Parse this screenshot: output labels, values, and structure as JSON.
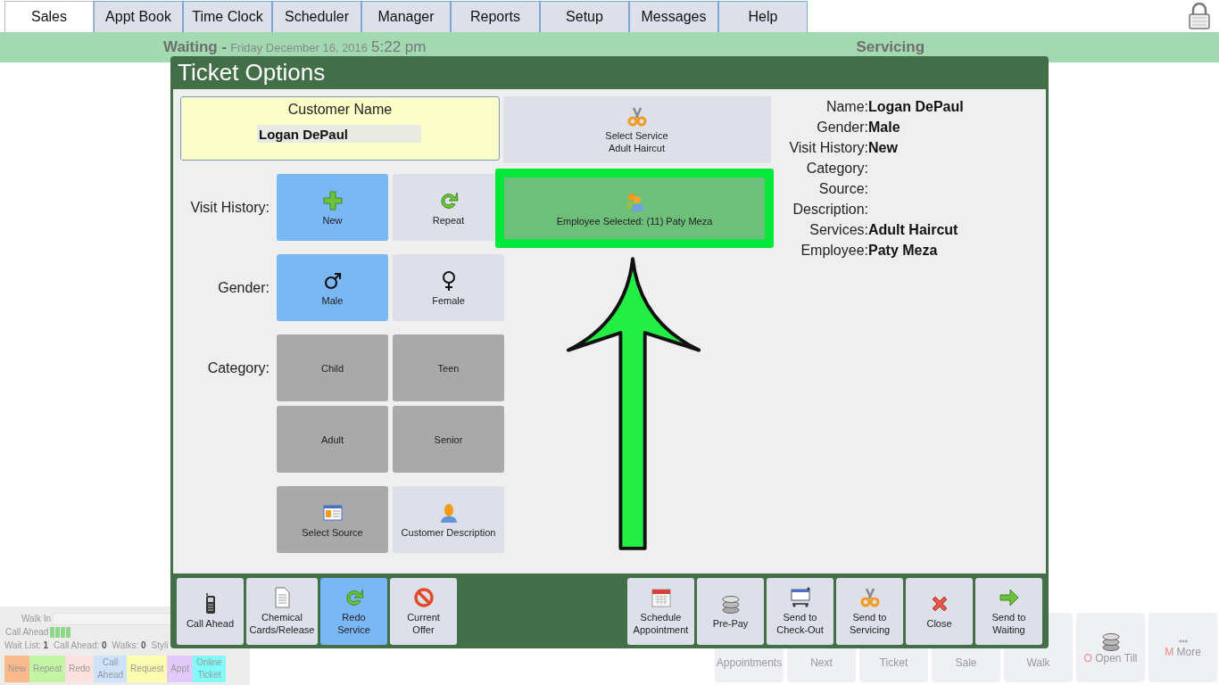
{
  "tabs": [
    {
      "label": "Sales",
      "selected": true
    },
    {
      "label": "Appt Book",
      "selected": false
    },
    {
      "label": "Time Clock",
      "selected": false
    },
    {
      "label": "Scheduler",
      "selected": false
    },
    {
      "label": "Manager",
      "selected": false
    },
    {
      "label": "Reports",
      "selected": false
    },
    {
      "label": "Setup",
      "selected": false
    },
    {
      "label": "Messages",
      "selected": false
    },
    {
      "label": "Help",
      "selected": false
    }
  ],
  "status_bar": {
    "waiting_label": "Waiting -",
    "date": "Friday December 16, 2016",
    "time": "5:22 pm",
    "servicing_label": "Servicing"
  },
  "queue_panel": {
    "walk_in_label": "Walk In",
    "call_ahead_label": "Call Ahead",
    "stats": [
      {
        "label": "Wait List:",
        "value": "1"
      },
      {
        "label": "Call Ahead:",
        "value": "0"
      },
      {
        "label": "Walks:",
        "value": "0"
      },
      {
        "label": "Styli"
      }
    ],
    "legend": [
      {
        "lines": [
          "New"
        ],
        "color": "#f9b98a"
      },
      {
        "lines": [
          "Repeat"
        ],
        "color": "#c3f5a5"
      },
      {
        "lines": [
          "Redo"
        ],
        "color": "#fde0e0"
      },
      {
        "lines": [
          "Call",
          "Ahead"
        ],
        "color": "#cce3fb"
      },
      {
        "lines": [
          "Request"
        ],
        "color": "#fdfdb0"
      },
      {
        "lines": [
          "Appt"
        ],
        "color": "#e3c9fa"
      },
      {
        "lines": [
          "Online",
          "Ticket"
        ],
        "color": "#80fbf7"
      }
    ]
  },
  "quick_actions": [
    {
      "kind": "partial",
      "lines": [
        "Appointments"
      ]
    },
    {
      "kind": "partial",
      "lines": [
        "Next"
      ]
    },
    {
      "kind": "partial",
      "lines": [
        "Ticket"
      ]
    },
    {
      "kind": "partial",
      "lines": [
        "Sale"
      ]
    },
    {
      "kind": "partial",
      "lines": [
        "Walk"
      ]
    },
    {
      "kind": "full",
      "hotkey": "O",
      "lines": [
        "Open Till"
      ]
    },
    {
      "kind": "full",
      "hotkey": "M",
      "lines": [
        "More"
      ]
    }
  ],
  "dialog": {
    "title": "Ticket Options",
    "customer_name": {
      "label": "Customer Name",
      "value": "Logan DePaul"
    },
    "visit_history": {
      "label": "Visit History:",
      "options": [
        {
          "label": "New",
          "selected": true,
          "dimmed": false
        },
        {
          "label": "Repeat",
          "selected": false,
          "dimmed": false
        }
      ]
    },
    "gender": {
      "label": "Gender:",
      "options": [
        {
          "label": "Male",
          "selected": true,
          "dimmed": false
        },
        {
          "label": "Female",
          "selected": false,
          "dimmed": false
        }
      ]
    },
    "category": {
      "label": "Category:",
      "options": [
        {
          "label": "Child",
          "selected": false,
          "dimmed": true
        },
        {
          "label": "Teen",
          "selected": false,
          "dimmed": true
        },
        {
          "label": "Adult",
          "selected": false,
          "dimmed": true
        },
        {
          "label": "Senior",
          "selected": false,
          "dimmed": true
        }
      ]
    },
    "extras": [
      {
        "label": "Select Source",
        "selected": false,
        "dimmed": true
      },
      {
        "label": "Customer Description",
        "selected": false,
        "dimmed": false
      }
    ],
    "service_button": {
      "title": "Select Service",
      "value": "Adult Haircut"
    },
    "employee_button": {
      "text": "Employee Selected: (11) Paty Meza",
      "highlighted": true
    },
    "summary": [
      {
        "label": "Name:",
        "value": "Logan DePaul"
      },
      {
        "label": "Gender:",
        "value": "Male"
      },
      {
        "label": "Visit History:",
        "value": "New"
      },
      {
        "label": "Category:"
      },
      {
        "label": "Source:"
      },
      {
        "label": "Description:"
      },
      {
        "label": "Services:",
        "value": "Adult Haircut"
      },
      {
        "label": "Employee:",
        "value": "Paty Meza"
      }
    ],
    "footer_left": [
      {
        "lines": [
          "Call Ahead"
        ],
        "selected": false
      },
      {
        "lines": [
          "Chemical",
          "Cards/Release"
        ],
        "selected": false
      },
      {
        "lines": [
          "Redo",
          "Service"
        ],
        "selected": true
      },
      {
        "lines": [
          "Current",
          "Offer"
        ],
        "selected": false
      }
    ],
    "footer_right": [
      {
        "lines": [
          "Schedule",
          "Appointment"
        ],
        "selected": false
      },
      {
        "lines": [
          "Pre-Pay"
        ],
        "selected": false
      },
      {
        "lines": [
          "Send to",
          "Check-Out"
        ],
        "selected": false
      },
      {
        "lines": [
          "Send to",
          "Servicing"
        ],
        "selected": false
      },
      {
        "lines": [
          "Close"
        ],
        "selected": false
      },
      {
        "lines": [
          "Send to",
          "Waiting"
        ],
        "selected": false
      }
    ]
  }
}
